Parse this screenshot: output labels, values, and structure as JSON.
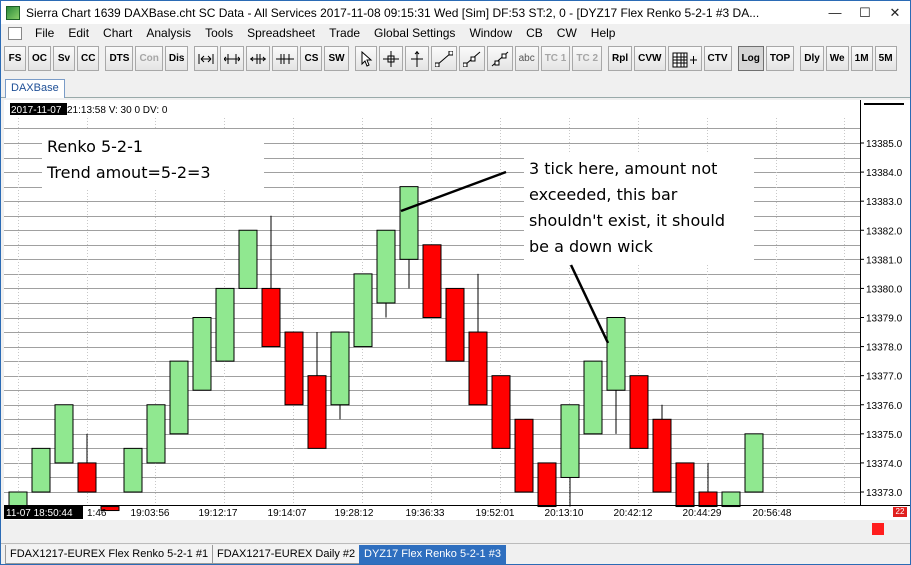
{
  "window": {
    "title": "Sierra Chart 1639 DAXBase.cht  SC Data - All Services 2017-11-08  09:15:31 Wed [Sim]  DF:53  ST:2, 0 - [DYZ17  Flex Renko 5-2-1  #3  DA...",
    "minimize_glyph": "—",
    "maximize_glyph": "☐",
    "close_glyph": "✕"
  },
  "menu": [
    "File",
    "Edit",
    "Chart",
    "Analysis",
    "Tools",
    "Spreadsheet",
    "Trade",
    "Global Settings",
    "Window",
    "CB",
    "CW",
    "Help"
  ],
  "toolbar": {
    "left_buttons": [
      "FS",
      "OC",
      "Sv",
      "CC",
      "DTS",
      "Con",
      "Dis"
    ],
    "mid_buttons": [
      "CS",
      "SW"
    ],
    "text_buttons": [
      "abc",
      "TC 1",
      "TC 2",
      "Rpl",
      "CVW",
      "CTV",
      "Log",
      "TOP",
      "Dly",
      "We",
      "1M",
      "5M"
    ],
    "icons": [
      "bar-spacing-icon",
      "bar-spacing-arrows-icon",
      "bar-spacing-left-icon",
      "bar-spacing-right-icon",
      "pointer-icon",
      "crosshair-icon",
      "cursor-line-icon",
      "draw-line-icon",
      "draw-ray-icon",
      "draw-extend-icon",
      "dom-icon"
    ]
  },
  "chart_tab": "DAXBase",
  "info_line": {
    "date": "2017-11-07",
    "rest": " 21:13:58 V: 30 0 DV: 0"
  },
  "annotations": {
    "left_title": "Renko 5-2-1",
    "left_sub": "Trend amout=5-2=3",
    "right_note": [
      "3 tick here, amount not",
      "exceeded, this bar",
      "shouldn't exist, it should",
      "be a down wick"
    ]
  },
  "time_axis": {
    "cursor_label": "11-07  18:50:44",
    "partial_label": "1:46",
    "labels": [
      "19:03:56",
      "19:12:17",
      "19:14:07",
      "19:28:12",
      "19:36:33",
      "19:52:01",
      "20:13:10",
      "20:42:12",
      "20:44:29",
      "20:56:48"
    ]
  },
  "price_labels": [
    "13373.0",
    "13374.0",
    "13375.0",
    "13376.0",
    "13377.0",
    "13378.0",
    "13379.0",
    "13380.0",
    "13381.0",
    "13382.0",
    "13383.0",
    "13384.0",
    "13385.0"
  ],
  "corner_badge": "22",
  "bottom_tabs": [
    "FDAX1217-EUREX  Flex Renko 5-2-1  #1",
    "FDAX1217-EUREX  Daily  #2",
    "DYZ17  Flex Renko 5-2-1  #3"
  ],
  "colors": {
    "up": "#90e890",
    "down": "#ff0000",
    "grid": "#a0a0a0",
    "cursor_bg": "#000000"
  },
  "chart_data": {
    "type": "renko",
    "title": "",
    "y_unit": "price",
    "ylim": [
      13372.5,
      13386.0
    ],
    "bricks": [
      {
        "open": 13372.5,
        "close": 13373.0,
        "dir": "up"
      },
      {
        "open": 13373.0,
        "close": 13374.5,
        "dir": "up"
      },
      {
        "open": 13374.0,
        "close": 13376.0,
        "dir": "up"
      },
      {
        "open": 13374.0,
        "close": 13373.0,
        "dir": "down",
        "high": 13375.0
      },
      {
        "open": 13372.5,
        "close": 13372.5,
        "dir": "down"
      },
      {
        "open": 13373.0,
        "close": 13374.5,
        "dir": "up"
      },
      {
        "open": 13374.0,
        "close": 13376.0,
        "dir": "up"
      },
      {
        "open": 13375.0,
        "close": 13377.5,
        "dir": "up"
      },
      {
        "open": 13376.5,
        "close": 13379.0,
        "dir": "up"
      },
      {
        "open": 13377.5,
        "close": 13380.0,
        "dir": "up"
      },
      {
        "open": 13380.0,
        "close": 13382.0,
        "dir": "up"
      },
      {
        "open": 13380.0,
        "close": 13378.0,
        "dir": "down",
        "high": 13382.5
      },
      {
        "open": 13378.5,
        "close": 13376.0,
        "dir": "down"
      },
      {
        "open": 13377.0,
        "close": 13374.5,
        "dir": "down",
        "high": 13378.5
      },
      {
        "open": 13376.0,
        "close": 13378.5,
        "dir": "up",
        "low": 13375.5
      },
      {
        "open": 13378.0,
        "close": 13380.5,
        "dir": "up"
      },
      {
        "open": 13379.5,
        "close": 13382.0,
        "dir": "up",
        "low": 13379.0
      },
      {
        "open": 13381.0,
        "close": 13383.5,
        "dir": "up",
        "low": 13380.0
      },
      {
        "open": 13381.5,
        "close": 13379.0,
        "dir": "down"
      },
      {
        "open": 13380.0,
        "close": 13377.5,
        "dir": "down"
      },
      {
        "open": 13378.5,
        "close": 13376.0,
        "dir": "down",
        "high": 13380.5
      },
      {
        "open": 13377.0,
        "close": 13374.5,
        "dir": "down"
      },
      {
        "open": 13375.5,
        "close": 13373.0,
        "dir": "down"
      },
      {
        "open": 13374.0,
        "close": 13372.5,
        "dir": "down",
        "low": 13372.5
      },
      {
        "open": 13373.5,
        "close": 13376.0,
        "dir": "up",
        "low": 13372.5
      },
      {
        "open": 13375.0,
        "close": 13377.5,
        "dir": "up"
      },
      {
        "open": 13376.5,
        "close": 13379.0,
        "dir": "up",
        "low": 13375.0
      },
      {
        "open": 13377.0,
        "close": 13374.5,
        "dir": "down"
      },
      {
        "open": 13375.5,
        "close": 13373.0,
        "dir": "down",
        "high": 13376.0
      },
      {
        "open": 13374.0,
        "close": 13372.5,
        "dir": "down"
      },
      {
        "open": 13373.0,
        "close": 13372.5,
        "dir": "down",
        "high": 13374.0
      },
      {
        "open": 13372.5,
        "close": 13373.0,
        "dir": "up"
      },
      {
        "open": 13373.0,
        "close": 13375.0,
        "dir": "up"
      }
    ]
  }
}
